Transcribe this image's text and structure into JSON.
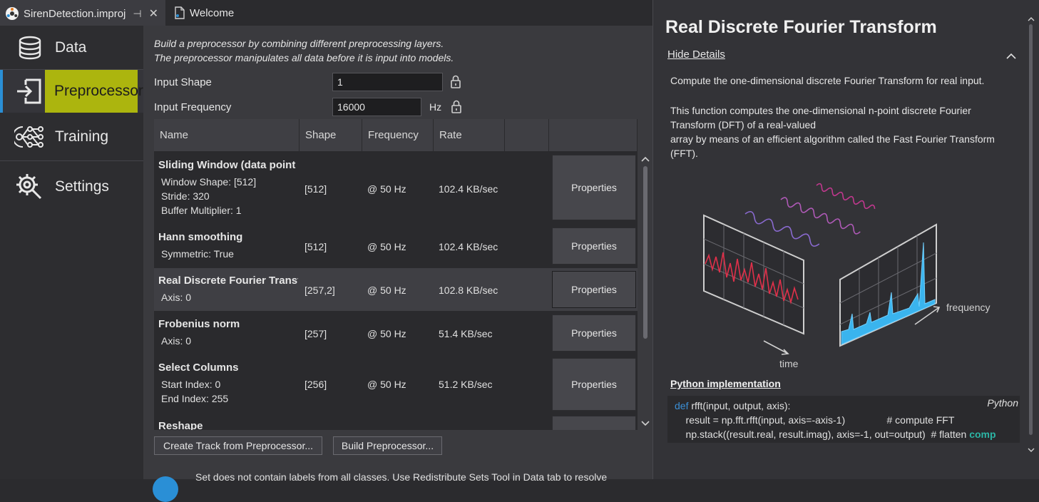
{
  "tabs": [
    {
      "label": "SirenDetection.improj",
      "pin": "⊣"
    },
    {
      "label": "Welcome"
    }
  ],
  "nav": {
    "items": [
      {
        "label": "Data",
        "icon": "database-icon"
      },
      {
        "label": "Preprocessor",
        "icon": "import-icon"
      },
      {
        "label": "Training",
        "icon": "neural-network-icon"
      },
      {
        "label": "Settings",
        "icon": "gear-wrench-icon"
      }
    ],
    "active": "Preprocessor",
    "highlight_color": "#d4e000"
  },
  "main": {
    "intro_line1": "Build a preprocessor by combining different preprocessing layers.",
    "intro_line2": "The preprocessor manipulates all data before it is input into models.",
    "input_shape_label": "Input Shape",
    "input_shape_value": "1",
    "input_frequency_label": "Input Frequency",
    "input_frequency_value": "16000",
    "frequency_unit": "Hz"
  },
  "table": {
    "headers": [
      "Name",
      "Shape",
      "Frequency",
      "Rate"
    ],
    "rows": [
      {
        "name": "Sliding Window (data point",
        "params": [
          "Window Shape: [512]",
          "Stride: 320",
          "Buffer Multiplier: 1"
        ],
        "shape": "[512]",
        "frequency": "@ 50 Hz",
        "rate": "102.4 KB/sec",
        "button": "Properties"
      },
      {
        "name": "Hann smoothing",
        "params": [
          "Symmetric: True"
        ],
        "shape": "[512]",
        "frequency": "@ 50 Hz",
        "rate": "102.4 KB/sec",
        "button": "Properties"
      },
      {
        "name": "Real Discrete Fourier Transf",
        "params": [
          "Axis: 0"
        ],
        "shape": "[257,2]",
        "frequency": "@ 50 Hz",
        "rate": "102.8 KB/sec",
        "button": "Properties"
      },
      {
        "name": "Frobenius norm",
        "params": [
          "Axis: 0"
        ],
        "shape": "[257]",
        "frequency": "@ 50 Hz",
        "rate": "51.4 KB/sec",
        "button": "Properties"
      },
      {
        "name": "Select Columns",
        "params": [
          "Start Index: 0",
          "End Index: 255"
        ],
        "shape": "[256]",
        "frequency": "@ 50 Hz",
        "rate": "51.2 KB/sec",
        "button": "Properties"
      },
      {
        "name": "Reshape",
        "params": [],
        "shape": "",
        "frequency": "",
        "rate": "",
        "button": ""
      }
    ]
  },
  "buttons": {
    "create_track": "Create Track from Preprocessor...",
    "build": "Build Preprocessor..."
  },
  "footer_message": "Set does not contain labels from all classes. Use Redistribute Sets Tool in Data tab to resolve",
  "details": {
    "title": "Real Discrete Fourier Transform",
    "hide_details": "Hide Details",
    "para1": "Compute the one-dimensional discrete Fourier Transform for real input.",
    "para2_line1": "This function computes the one-dimensional n-point discrete Fourier",
    "para2_line2": "Transform (DFT) of a real-valued",
    "para2_line3": "array by means of an efficient algorithm called the Fast Fourier Transform",
    "para2_line4": "(FFT).",
    "diagram_label_frequency": "frequency",
    "diagram_label_time": "time",
    "python_heading": "Python implementation",
    "code_lang": "Python",
    "code_kw": "def",
    "code_line1_rest": " rfft(input, output, axis):",
    "code_line2": "    result = np.fft.rfft(input, axis=-axis-1)               # compute FFT",
    "code_line3": "    np.stack((result.real, result.imag), axis=-1, out=output)  # flatten ",
    "code_line3_tail": "comp"
  }
}
